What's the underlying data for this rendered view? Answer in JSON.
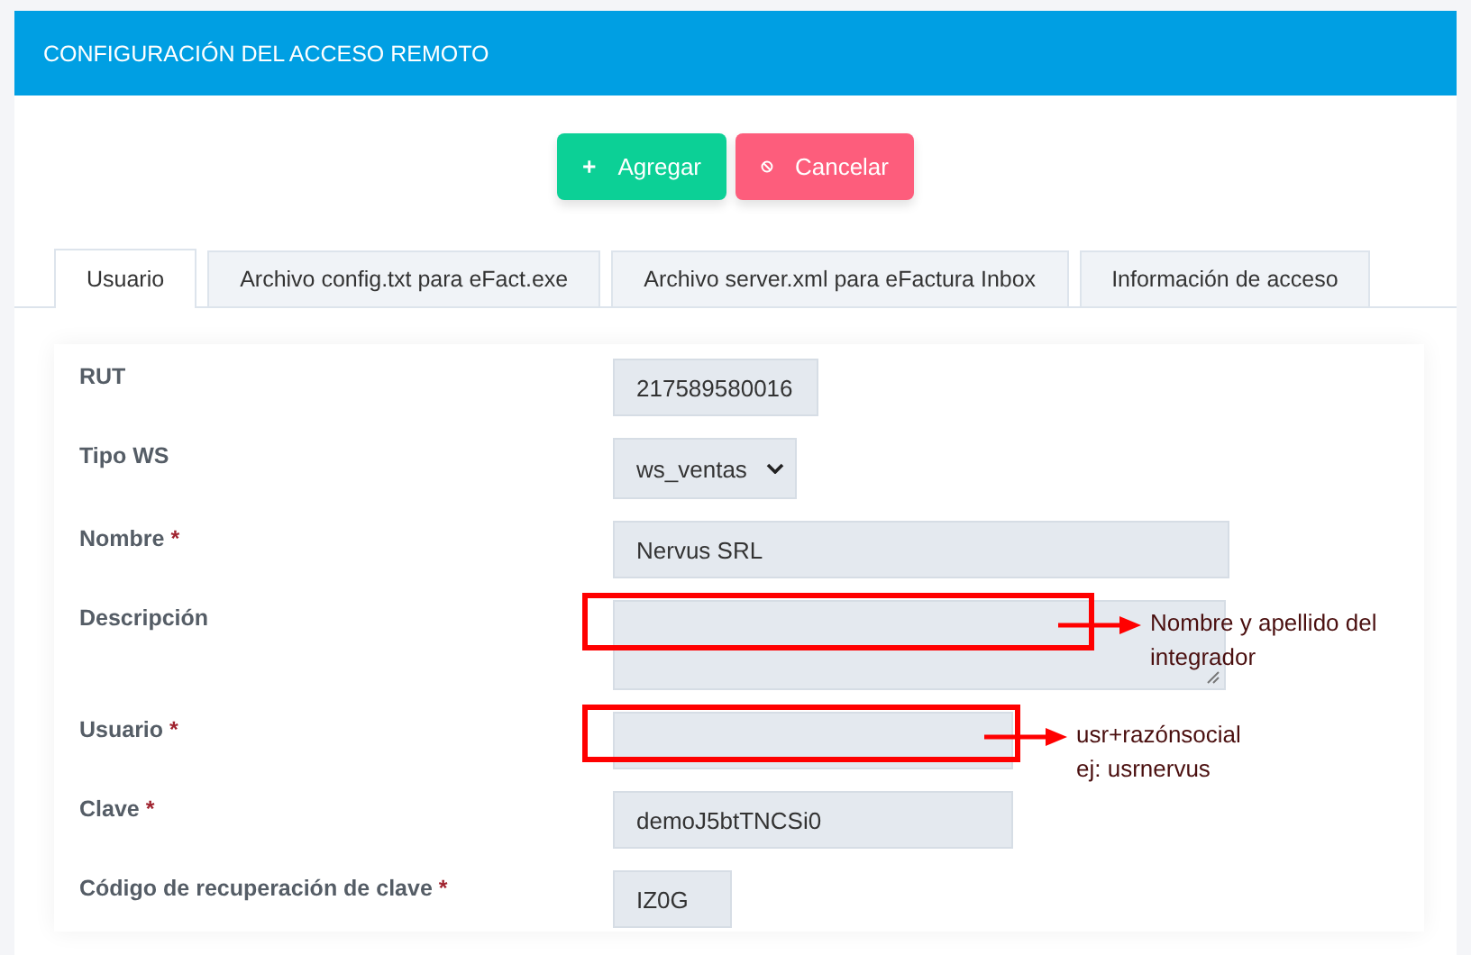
{
  "header": {
    "title": "CONFIGURACIÓN DEL ACCESO REMOTO"
  },
  "actions": [
    {
      "kind": "add",
      "label": "Agregar"
    },
    {
      "kind": "cancel",
      "label": "Cancelar"
    }
  ],
  "tabs": [
    {
      "label": "Usuario",
      "selected": true
    },
    {
      "label": "Archivo config.txt para eFact.exe",
      "selected": false
    },
    {
      "label": "Archivo server.xml para eFactura Inbox",
      "selected": false
    },
    {
      "label": "Información de acceso",
      "selected": false
    }
  ],
  "fields": [
    {
      "label": "RUT",
      "kind": "text",
      "value": "217589580016"
    },
    {
      "label": "Tipo WS",
      "kind": "select",
      "value": "ws_ventas"
    },
    {
      "label": "Nombre",
      "required_mark": "*",
      "kind": "text",
      "value": "Nervus SRL"
    },
    {
      "label": "Descripción",
      "kind": "textarea",
      "annotation": [
        "Nombre y apellido del integrador"
      ]
    },
    {
      "label": "Usuario",
      "required_mark": "*",
      "kind": "text",
      "annotation": [
        "usr+razónsocial",
        "ej: usrnervus"
      ]
    },
    {
      "label": "Clave",
      "required_mark": "*",
      "kind": "text",
      "value": "demoJ5btTNCSi0"
    },
    {
      "label": "Código de recuperación de clave",
      "required_mark": "*",
      "kind": "text",
      "value": "IZ0G"
    }
  ]
}
